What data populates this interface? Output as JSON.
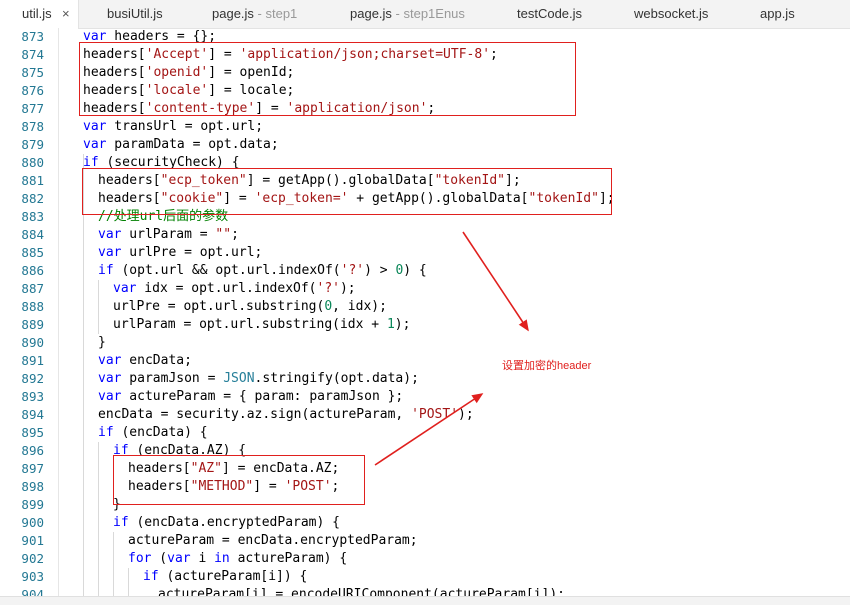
{
  "tabs": [
    {
      "label": "util.js",
      "sub": "",
      "active": true,
      "close": "×"
    },
    {
      "label": "busiUtil.js",
      "sub": ""
    },
    {
      "label": "page.js",
      "sub": " - step1"
    },
    {
      "label": "page.js",
      "sub": " - step1Enus"
    },
    {
      "label": "testCode.js",
      "sub": ""
    },
    {
      "label": "websocket.js",
      "sub": ""
    },
    {
      "label": "app.js",
      "sub": ""
    }
  ],
  "editor": {
    "line_numbers": [
      "873",
      "874",
      "875",
      "876",
      "877",
      "878",
      "879",
      "880",
      "881",
      "882",
      "883",
      "884",
      "885",
      "886",
      "887",
      "888",
      "889",
      "890",
      "891",
      "892",
      "893",
      "894",
      "895",
      "896",
      "897",
      "898",
      "899",
      "900",
      "901",
      "902",
      "903",
      "904"
    ]
  },
  "annotation": {
    "text": "设置加密的header"
  },
  "colors": {
    "keyword": "#0000ff",
    "string": "#a31515",
    "number": "#098658",
    "comment": "#008000",
    "annotation": "#e0201e"
  }
}
